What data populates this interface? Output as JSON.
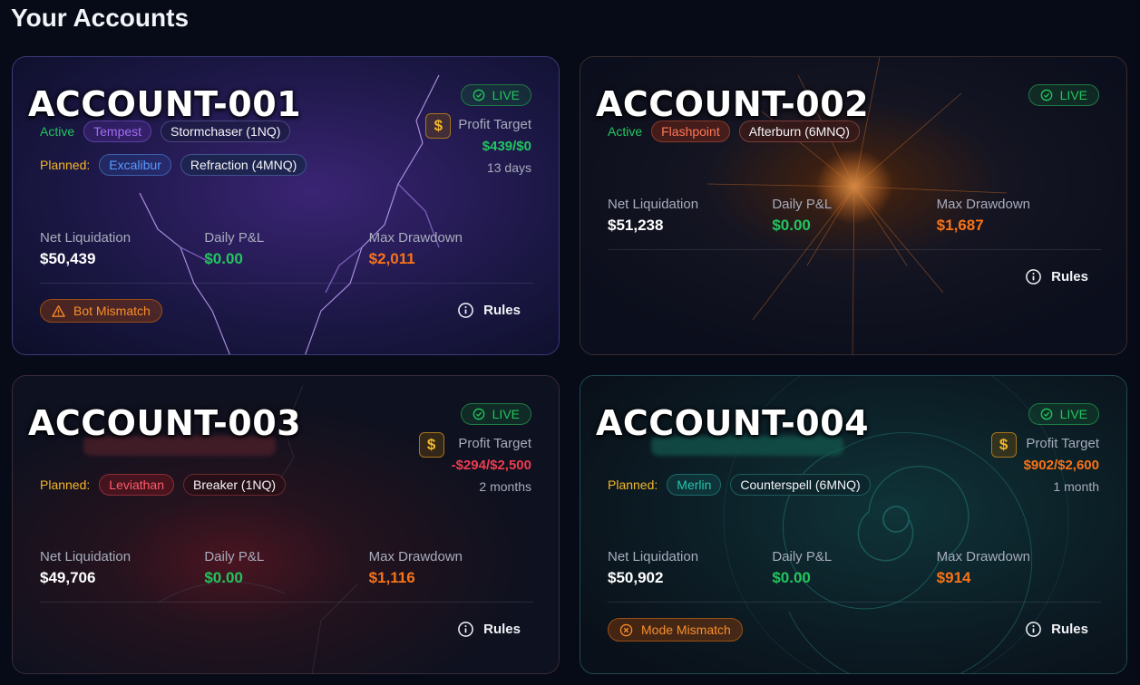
{
  "page": {
    "title": "Your Accounts"
  },
  "accounts": [
    {
      "name": "ACCOUNT-001",
      "status": "LIVE",
      "active": {
        "label": "Active",
        "strategy": "Tempest",
        "bot": "Stormchaser (1NQ)"
      },
      "planned": {
        "label": "Planned:",
        "strategy": "Excalibur",
        "bot": "Refraction (4MNQ)"
      },
      "profit_target": {
        "label": "Profit Target",
        "value": "$439/$0",
        "time": "13 days"
      },
      "metrics": {
        "net_liquidation": {
          "label": "Net Liquidation",
          "value": "$50,439"
        },
        "daily_pnl": {
          "label": "Daily P&L",
          "value": "$0.00"
        },
        "max_drawdown": {
          "label": "Max Drawdown",
          "value": "$2,011"
        }
      },
      "warning": "Bot Mismatch",
      "rules": "Rules"
    },
    {
      "name": "ACCOUNT-002",
      "status": "LIVE",
      "active": {
        "label": "Active",
        "strategy": "Flashpoint",
        "bot": "Afterburn (6MNQ)"
      },
      "metrics": {
        "net_liquidation": {
          "label": "Net Liquidation",
          "value": "$51,238"
        },
        "daily_pnl": {
          "label": "Daily P&L",
          "value": "$0.00"
        },
        "max_drawdown": {
          "label": "Max Drawdown",
          "value": "$1,687"
        }
      },
      "rules": "Rules"
    },
    {
      "name": "ACCOUNT-003",
      "status": "LIVE",
      "planned": {
        "label": "Planned:",
        "strategy": "Leviathan",
        "bot": "Breaker (1NQ)"
      },
      "profit_target": {
        "label": "Profit Target",
        "value": "-$294/$2,500",
        "time": "2 months"
      },
      "metrics": {
        "net_liquidation": {
          "label": "Net Liquidation",
          "value": "$49,706"
        },
        "daily_pnl": {
          "label": "Daily P&L",
          "value": "$0.00"
        },
        "max_drawdown": {
          "label": "Max Drawdown",
          "value": "$1,116"
        }
      },
      "rules": "Rules"
    },
    {
      "name": "ACCOUNT-004",
      "status": "LIVE",
      "planned": {
        "label": "Planned:",
        "strategy": "Merlin",
        "bot": "Counterspell (6MNQ)"
      },
      "profit_target": {
        "label": "Profit Target",
        "value": "$902/$2,600",
        "time": "1 month"
      },
      "metrics": {
        "net_liquidation": {
          "label": "Net Liquidation",
          "value": "$50,902"
        },
        "daily_pnl": {
          "label": "Daily P&L",
          "value": "$0.00"
        },
        "max_drawdown": {
          "label": "Max Drawdown",
          "value": "$914"
        }
      },
      "warning": "Mode Mismatch",
      "rules": "Rules"
    }
  ],
  "icons": {
    "live": "check-circle-icon",
    "profit_target": "dollar-icon",
    "bot_mismatch": "warning-triangle-icon",
    "mode_mismatch": "x-circle-icon",
    "rules": "info-circle-icon"
  },
  "colors": {
    "background": "#070b18",
    "live_green": "#22c55e",
    "positive": "#22c55e",
    "negative": "#ef3b4f",
    "drawdown": "#f97316",
    "planned_label": "#f5b72a",
    "warning": "#f98e2a"
  }
}
